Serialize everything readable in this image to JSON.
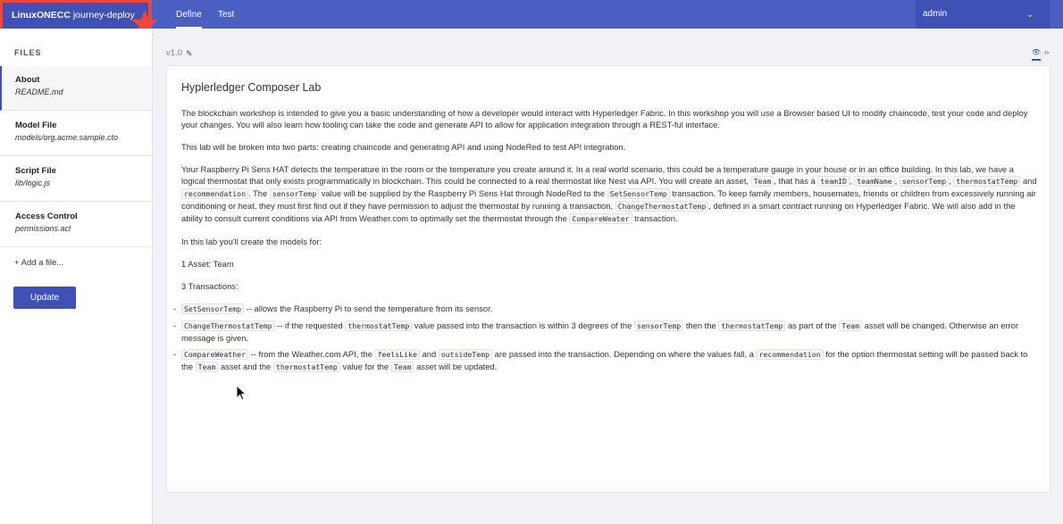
{
  "header": {
    "brand_bold": "LinuxONECC",
    "brand_rest": "journey-deploy",
    "tabs": [
      "Define",
      "Test"
    ],
    "user": "admin"
  },
  "sidebar": {
    "title": "FILES",
    "files": [
      {
        "name": "About",
        "path": "README.md"
      },
      {
        "name": "Model File",
        "path": "models/org.acme.sample.cto"
      },
      {
        "name": "Script File",
        "path": "lib/logic.js"
      },
      {
        "name": "Access Control",
        "path": "permissions.acl"
      }
    ],
    "add_file": "+ Add a file...",
    "update": "Update"
  },
  "main": {
    "version": "v1.0",
    "doc": {
      "title": "Hyplerledger Composer Lab",
      "p1": "The blockchain workshop is intended to give you a basic understanding of how a developer would interact with Hyperledger Fabric. In this workshop you will use a Browser based UI to modify chaincode, test your code and deploy your changes. You will also learn how tooling can take the code and generate API to allow for application integration through a REST-ful interface.",
      "p2": "This lab will be broken into two parts: creating chaincode and generating API and using NodeRed to test API integration.",
      "p3": {
        "t1": "Your Raspberry Pi Sens HAT detects the temperature in the room or the temperature you create around it. In a real world scenario, this could be a temperature gauge in your house or in an office building. In this lab, we have a logical thermostat that only exists programmatically in blockchain. This could be connected to a real thermostat like Nest via API. You will create an asset,",
        "c1": "Team",
        "t2": ", that has a",
        "c2": "teamID",
        "t3": ",",
        "c3": "teamName",
        "t4": ",",
        "c4": "sensorTemp",
        "t5": ",",
        "c5": "thermostatTemp",
        "t6": "and",
        "c6": "recommendation",
        "t7": ". The",
        "c7": "sensorTemp",
        "t8": "value will be supplied by the Raspberry Pi Sens Hat through NodeRed to the",
        "c8": "SetSensorTemp",
        "t9": "transaction. To keep family members, housemates, friends or children from excessively running air conditioning or heat, they must first find out if they have permission to adjust the thermostat by running a transaction,",
        "c9": "ChangeThermostatTemp",
        "t10": ", defined in a smart contract running on Hyperledger Fabric. We will also add in the ability to consult current conditions via API from Weather.com to optimally set the thermostat through the",
        "c10": "CompareWeater",
        "t11": "transaction."
      },
      "p4": "In this lab you'll create the models for:",
      "p5": "1 Asset: Team",
      "p6": "3 Transactions:",
      "items": [
        {
          "c1": "SetSensorTemp",
          "t1": "-- allows the Raspberry Pi to send the temperature from its sensor."
        },
        {
          "c1": "ChangeThermostatTemp",
          "t1": "-- if the requested",
          "c2": "thermostatTemp",
          "t2": "value passed into the transaction is within 3 degrees of the",
          "c3": "sensorTemp",
          "t3": "then the",
          "c4": "thermostatTemp",
          "t4": "as part of the",
          "c5": "Team",
          "t5": "asset will be changed. Otherwise an error message is given."
        },
        {
          "c1": "CompareWeather",
          "t1": "-- from the Weather.com API, the",
          "c2": "feelsLike",
          "t2": "and",
          "c3": "outsideTemp",
          "t3": "are passed into the transaction. Depending on where the values fall, a",
          "c4": "recommendation",
          "t4": "for the option thermostat setting will be passed back to the",
          "c5": "Team",
          "t5": "asset and the",
          "c6": "thermostatTemp",
          "t6": "value for the",
          "c7": "Team",
          "t7": "asset will be updated."
        }
      ]
    }
  },
  "colors": {
    "primary": "#3f51b5",
    "topbar": "#4a5fc1",
    "highlight_border": "#f0463b",
    "star": "#f0463b"
  },
  "icons": [
    "star-icon",
    "chevron-down-icon",
    "pencil-icon",
    "eye-icon",
    "code-icon",
    "mouse-cursor-icon"
  ]
}
